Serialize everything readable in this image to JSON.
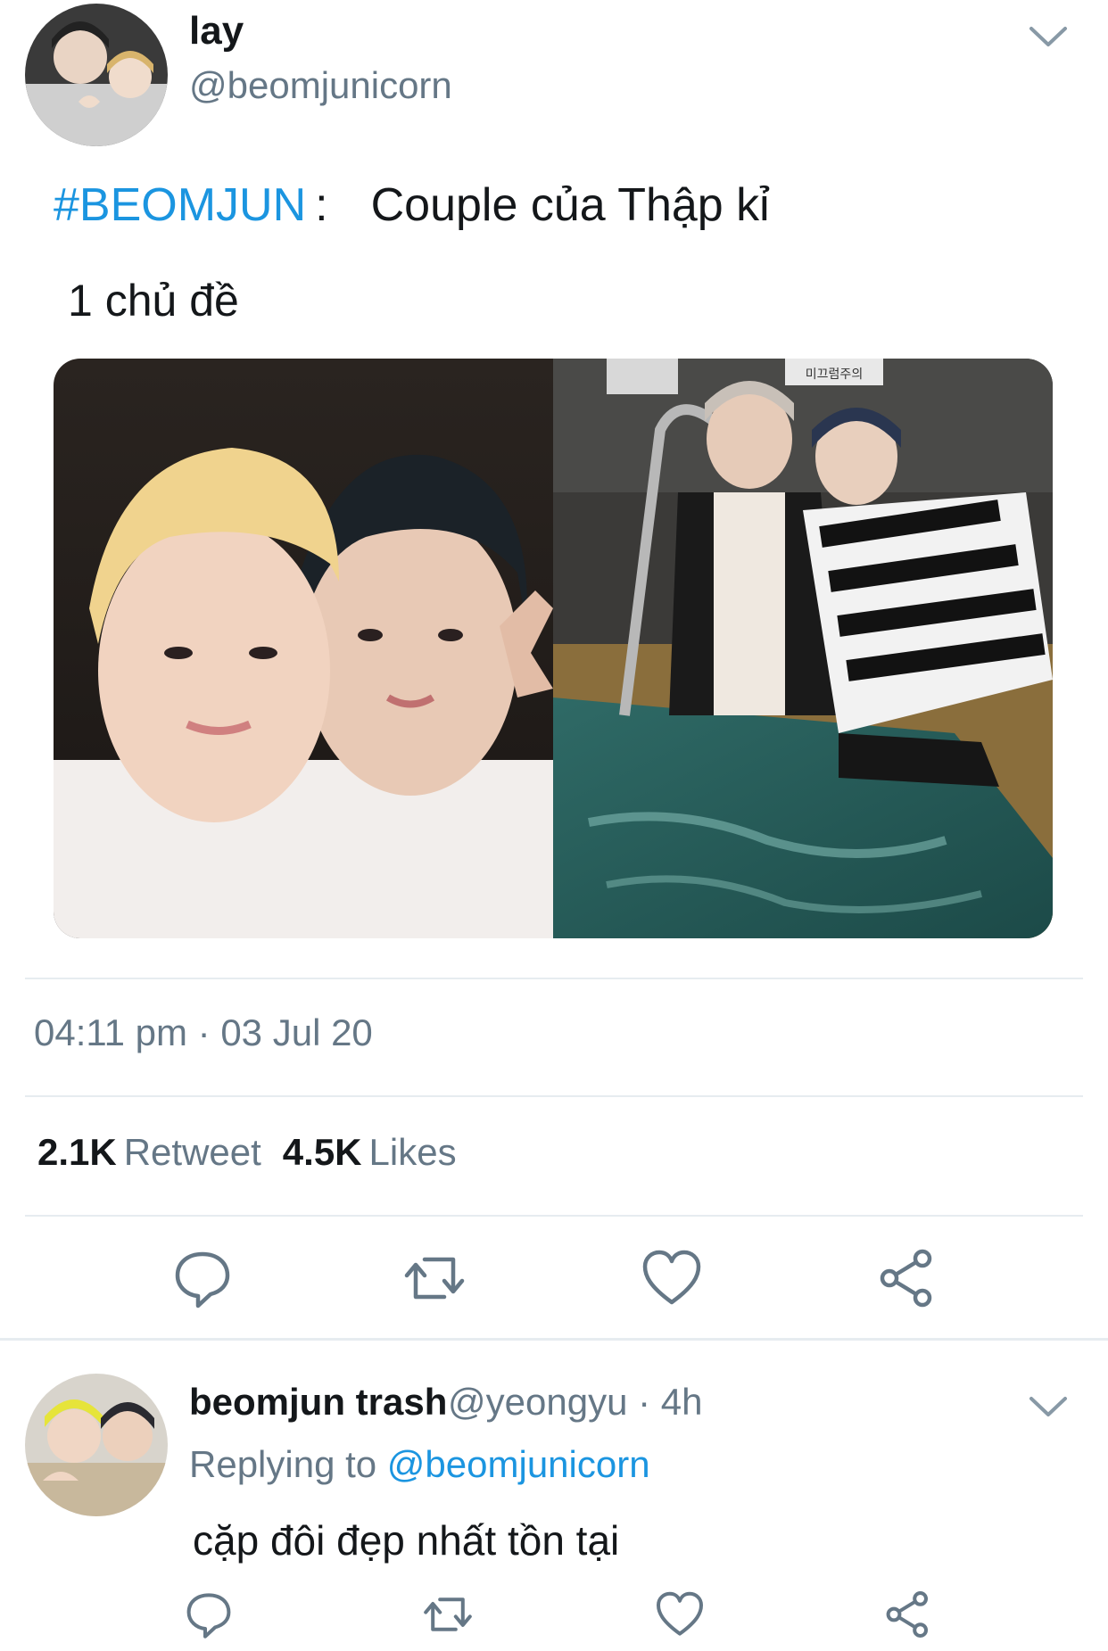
{
  "main_tweet": {
    "display_name": "lay",
    "handle": "@beomjunicorn",
    "hashtag": "#BEOMJUN",
    "colon": ":",
    "text": "Couple của Thập kỉ",
    "subtext": "1 chủ đề",
    "timestamp": "04:11 pm · 03 Jul 20",
    "stats": {
      "retweets_count": "2.1K",
      "retweets_label": "Retweet",
      "likes_count": "4.5K",
      "likes_label": "Likes"
    },
    "sign_text": "미끄럼주의"
  },
  "reply": {
    "display_name": "beomjun trash",
    "handle": "@yeongyu",
    "separator": "·",
    "age": "4h",
    "replying_prefix": "Replying to",
    "replying_handle": "@beomjunicorn",
    "text": "cặp đôi đẹp nhất tồn tại"
  },
  "icons": [
    "chevron-down-icon",
    "reply-icon",
    "retweet-icon",
    "like-icon",
    "share-icon"
  ],
  "colors": {
    "link": "#1b95e0",
    "secondary_text": "#657786",
    "primary_text": "#14171a",
    "divider": "#e6ecf0",
    "icon": "#657786"
  }
}
